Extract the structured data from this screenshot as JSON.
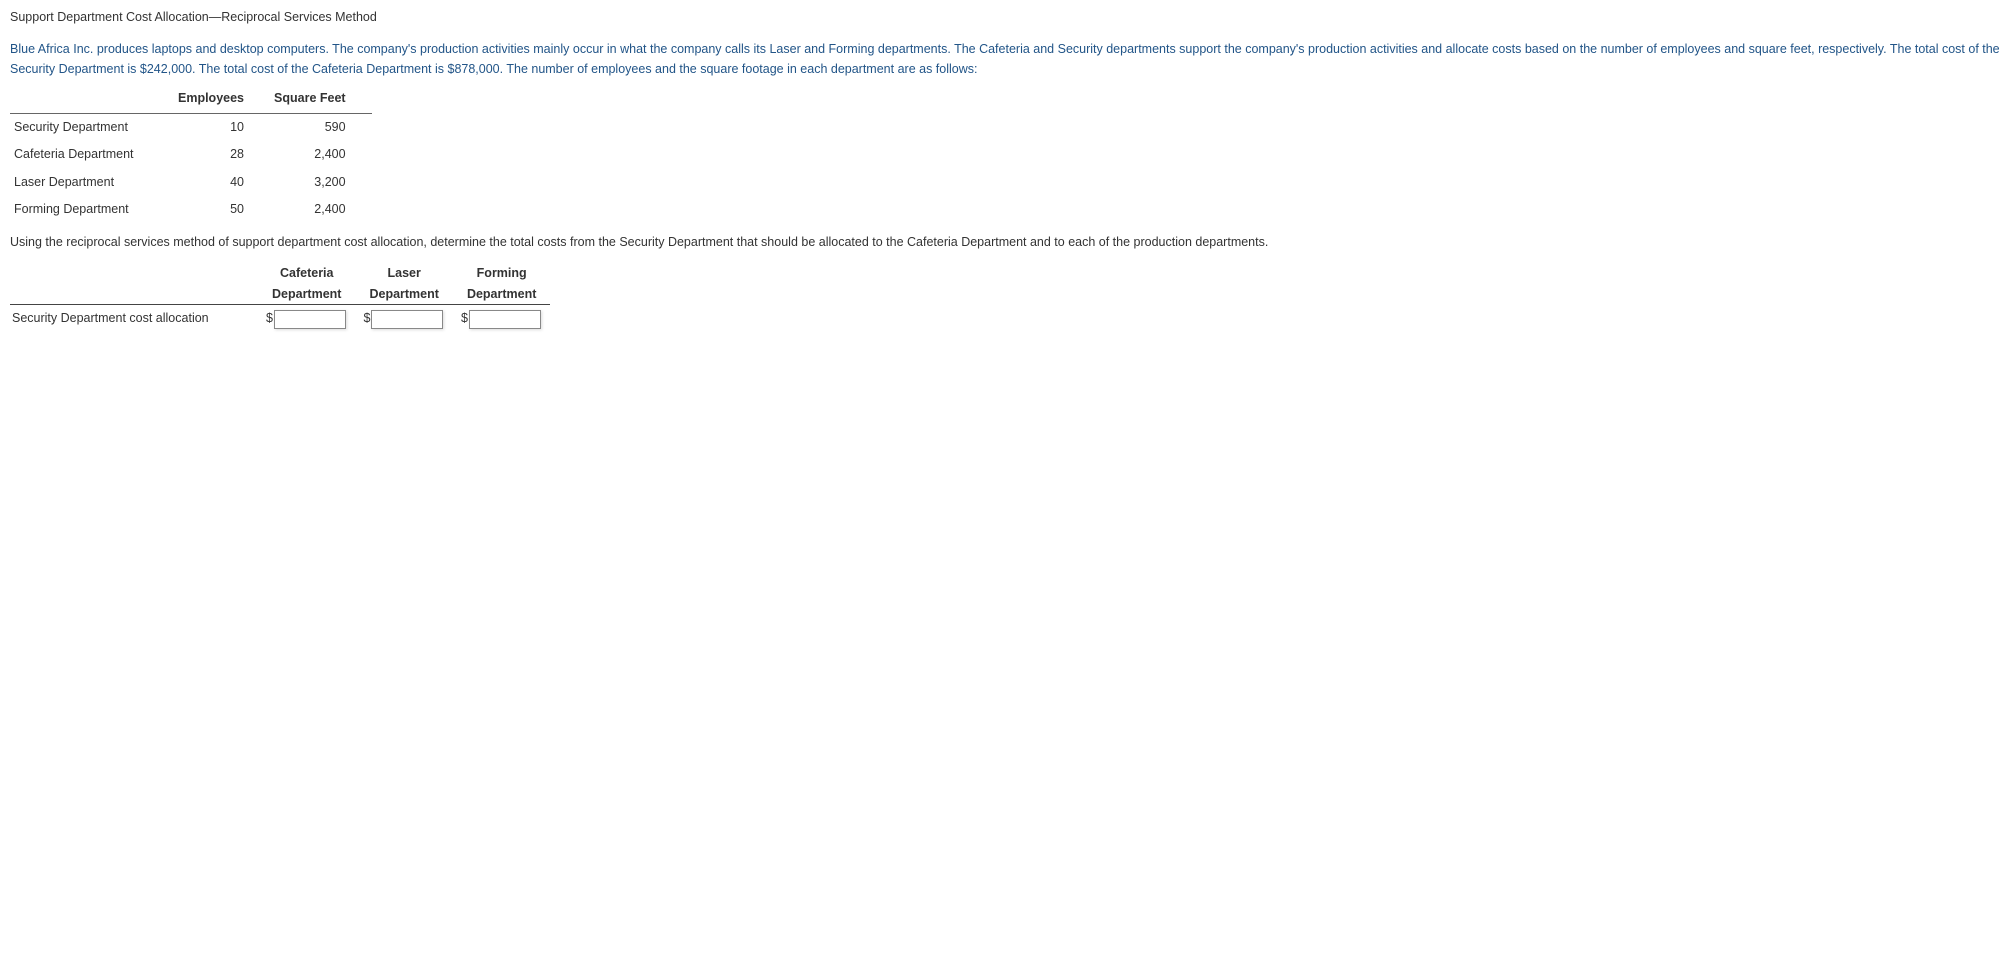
{
  "title": "Support Department Cost Allocation—Reciprocal Services Method",
  "intro": "Blue Africa Inc. produces laptops and desktop computers. The company's production activities mainly occur in what the company calls its Laser and Forming departments. The Cafeteria and Security departments support the company's production activities and allocate costs based on the number of employees and square feet, respectively. The total cost of the Security Department is $242,000. The total cost of the Cafeteria Department is $878,000. The number of employees and the square footage in each department are as follows:",
  "data_table": {
    "headers": {
      "col1": "",
      "col2": "Employees",
      "col3": "Square Feet"
    },
    "rows": [
      {
        "dept": "Security Department",
        "employees": "10",
        "sqft": "590"
      },
      {
        "dept": "Cafeteria Department",
        "employees": "28",
        "sqft": "2,400"
      },
      {
        "dept": "Laser Department",
        "employees": "40",
        "sqft": "3,200"
      },
      {
        "dept": "Forming Department",
        "employees": "50",
        "sqft": "2,400"
      }
    ]
  },
  "instruction": "Using the reciprocal services method of support department cost allocation, determine the total costs from the Security Department that should be allocated to the Cafeteria Department and to each of the production departments.",
  "alloc_table": {
    "headers": {
      "line1": {
        "col1": "",
        "col2": "Cafeteria",
        "col3": "Laser",
        "col4": "Forming"
      },
      "line2": {
        "col1": "",
        "col2": "Department",
        "col3": "Department",
        "col4": "Department"
      }
    },
    "row_label": "Security Department cost allocation",
    "currency_symbol": "$",
    "values": {
      "cafeteria": "",
      "laser": "",
      "forming": ""
    }
  }
}
